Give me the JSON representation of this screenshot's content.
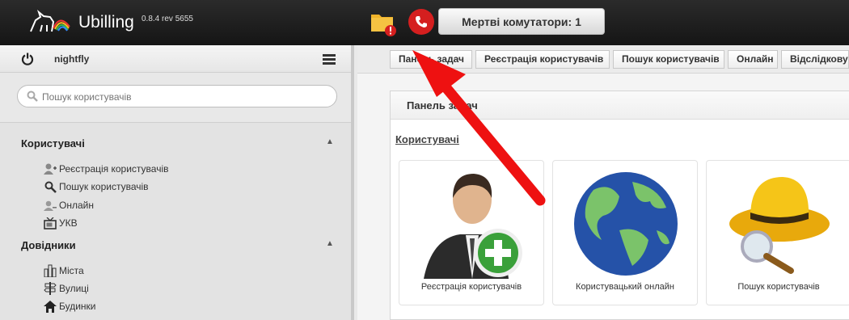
{
  "header": {
    "app_name": "Ubilling",
    "app_version": "0.8.4 rev 5655",
    "dead_switches_label": "Мертві комутатори: 1",
    "folder_icon": "folder-alert-icon",
    "phone_icon": "phone-alert-icon"
  },
  "sidebar": {
    "username": "nightfly",
    "search_placeholder": "Пошук користувачів",
    "sections": [
      {
        "title": "Користувачі",
        "items": [
          {
            "label": "Реєстрація користувачів",
            "icon": "user-add-icon"
          },
          {
            "label": "Пошук користувачів",
            "icon": "search-icon"
          },
          {
            "label": "Онлайн",
            "icon": "users-icon"
          },
          {
            "label": "УКВ",
            "icon": "tv-icon"
          }
        ]
      },
      {
        "title": "Довідники",
        "items": [
          {
            "label": "Міста",
            "icon": "city-icon"
          },
          {
            "label": "Вулиці",
            "icon": "signpost-icon"
          },
          {
            "label": "Будинки",
            "icon": "home-icon"
          }
        ]
      }
    ]
  },
  "breadcrumbs": [
    "Панель задач",
    "Реєстрація користувачів",
    "Пошук користувачів",
    "Онлайн",
    "Відслідковув"
  ],
  "panel": {
    "title": "Панель задач",
    "group_title": "Користувачі",
    "cards": [
      {
        "label": "Реєстрація користувачів",
        "icon": "user-add-icon"
      },
      {
        "label": "Користувацький онлайн",
        "icon": "globe-icon"
      },
      {
        "label": "Пошук користувачів",
        "icon": "detective-hat-icon"
      }
    ]
  },
  "colors": {
    "topbar": "#1e1e1e",
    "alert_red": "#d51f1f",
    "folder_yellow": "#f0b32a",
    "arrow_red": "#ee1111"
  }
}
